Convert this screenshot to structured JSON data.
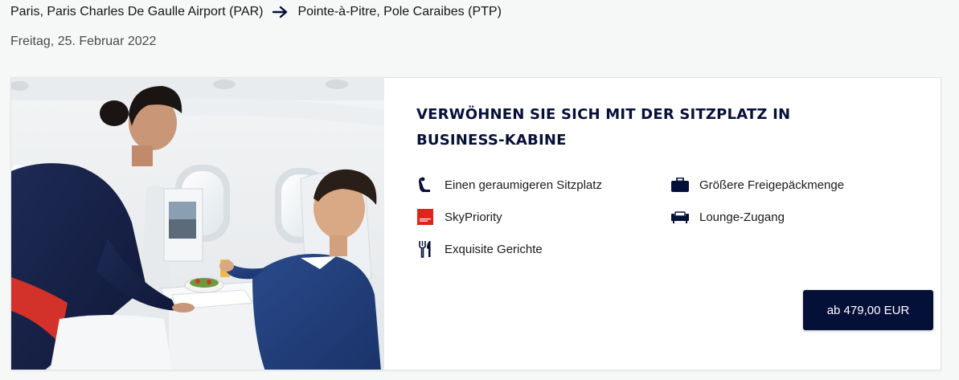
{
  "route": {
    "origin": "Paris, Paris Charles De Gaulle Airport (PAR)",
    "destination": "Pointe-à-Pitre, Pole Caraibes (PTP)"
  },
  "date": "Freitag, 25. Februar 2022",
  "offer": {
    "headline": "VERWÖHNEN SIE SICH MIT DER SITZPLATZ IN BUSINESS-KABINE",
    "features": [
      {
        "icon": "seat-icon",
        "label": "Einen geraumigeren Sitzplatz"
      },
      {
        "icon": "baggage-icon",
        "label": "Größere Freigepäckmenge"
      },
      {
        "icon": "skypriority-icon",
        "label": "SkyPriority"
      },
      {
        "icon": "lounge-icon",
        "label": "Lounge-Zugang"
      },
      {
        "icon": "cutlery-icon",
        "label": "Exquisite Gerichte"
      }
    ],
    "price_button": "ab 479,00 EUR"
  },
  "colors": {
    "brand_navy": "#051039",
    "skypriority_red": "#e2231a",
    "page_background": "#f6f7f7"
  }
}
